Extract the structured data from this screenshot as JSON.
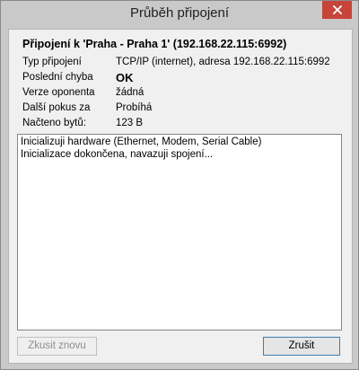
{
  "window": {
    "title": "Průběh připojení"
  },
  "connection": {
    "heading": "Připojení k 'Praha - Praha 1' (192.168.22.115:6992)",
    "rows": [
      {
        "label": "Typ připojení",
        "value": "TCP/IP (internet), adresa 192.168.22.115:6992"
      },
      {
        "label": "Poslední chyba",
        "value": "OK"
      },
      {
        "label": "Verze oponenta",
        "value": "žádná"
      },
      {
        "label": "Další pokus za",
        "value": "Probíhá"
      },
      {
        "label": "Načteno bytů:",
        "value": "123 B"
      }
    ]
  },
  "log": {
    "lines": [
      "Inicializuji hardware (Ethernet, Modem, Serial Cable)",
      "Inicializace dokončena, navazuji spojení..."
    ]
  },
  "buttons": {
    "retry_label": "Zkusit znovu",
    "cancel_label": "Zrušit"
  }
}
